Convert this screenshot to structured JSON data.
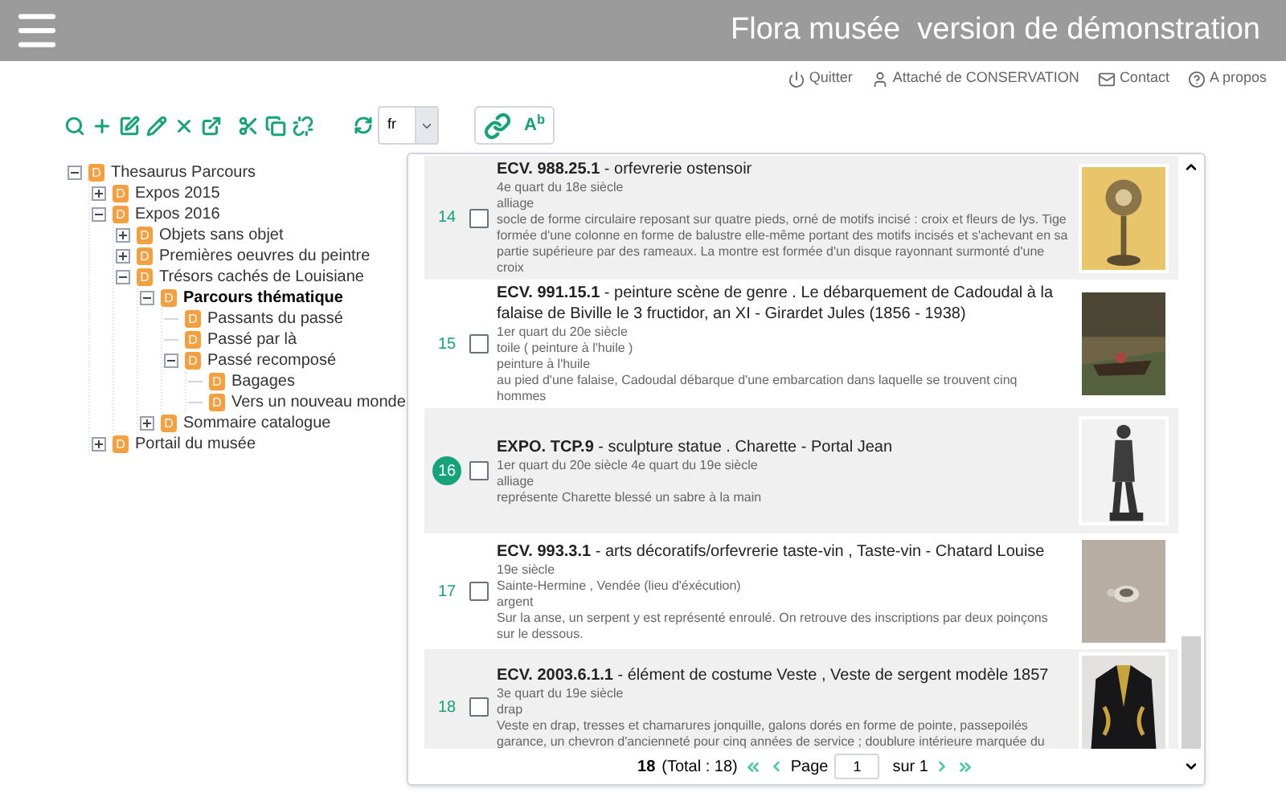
{
  "header": {
    "title": "Flora musée  version de démonstration"
  },
  "user_links": [
    {
      "kind": "power",
      "label": "Quitter"
    },
    {
      "kind": "user",
      "label": "Attaché de CONSERVATION"
    },
    {
      "kind": "mail",
      "label": "Contact"
    },
    {
      "kind": "help",
      "label": "A propos"
    }
  ],
  "toolbar": {
    "language": "fr",
    "format_label": "A$^{b}$"
  },
  "tree": [
    {
      "label": "Thesaurus Parcours",
      "badge": "D",
      "expanded": true,
      "bold": false,
      "children": [
        {
          "label": "Expos 2015",
          "badge": "D",
          "expanded": false,
          "bold": false
        },
        {
          "label": "Expos 2016",
          "badge": "D",
          "expanded": true,
          "bold": false,
          "children": [
            {
              "label": "Objets sans objet",
              "badge": "D",
              "expanded": false,
              "bold": false
            },
            {
              "label": "Premières oeuvres du peintre",
              "badge": "D",
              "expanded": false,
              "bold": false
            },
            {
              "label": "Trésors cachés de Louisiane",
              "badge": "D",
              "expanded": true,
              "bold": false,
              "children": [
                {
                  "label": "Parcours thématique",
                  "badge": "D",
                  "expanded": true,
                  "bold": true,
                  "children": [
                    {
                      "label": "Passants du passé",
                      "badge": "D"
                    },
                    {
                      "label": "Passé par là",
                      "badge": "D"
                    },
                    {
                      "label": "Passé recomposé",
                      "badge": "D",
                      "expanded": true,
                      "bold": false,
                      "children": [
                        {
                          "label": "Bagages",
                          "badge": "D"
                        },
                        {
                          "label": "Vers un nouveau monde",
                          "badge": "D"
                        }
                      ]
                    }
                  ]
                },
                {
                  "label": "Sommaire catalogue",
                  "badge": "D",
                  "expanded": false,
                  "bold": false
                }
              ]
            }
          ]
        },
        {
          "label": "Portail du musée",
          "badge": "D",
          "expanded": false,
          "bold": false
        }
      ]
    }
  ],
  "results": [
    {
      "number": "14",
      "selected": false,
      "checked": false,
      "title": "**ECV. 988.25.1** - orfevrerie ostensoir",
      "details": [
        "4e quart du 18e siècle",
        "alliage",
        "socle de forme circulaire reposant sur quatre pieds, orné de motifs incisé : croix et fleurs de lys. Tige formée d'une colonne en forme de balustre elle-même portant des motifs incisés et s'achevant en sa partie supérieure par des rameaux. La montre est formée d'un disque rayonnant surmonté d'une croix"
      ]
    },
    {
      "number": "15",
      "selected": false,
      "checked": false,
      "title": "**ECV. 991.15.1** - peinture scène de genre . Le débarquement de Cadoudal à la falaise de Biville le 3 fructidor, an XI - Girardet Jules  (1856 - 1938)",
      "details": [
        "1er quart du 20e siècle",
        "toile ( peinture à l'huile )",
        "peinture à l'huile",
        "au pied d'une falaise, Cadoudal débarque d'une embarcation dans laquelle se trouvent cinq hommes"
      ]
    },
    {
      "number": "16",
      "selected": true,
      "checked": false,
      "title": "**EXPO. TCP.9** - sculpture statue . Charette - Portal Jean",
      "details": [
        "1er quart du 20e siècle 4e quart du 19e siècle",
        "alliage",
        "représente Charette blessé un sabre à la main"
      ]
    },
    {
      "number": "17",
      "selected": false,
      "checked": false,
      "title": "**ECV. 993.3.1** - arts décoratifs/orfevrerie taste-vin , Taste-vin - Chatard Louise",
      "details": [
        "19e siècle",
        "Sainte-Hermine , Vendée (lieu d'éxécution)",
        "argent",
        "Sur la anse, un serpent y est représenté enroulé. On retrouve des inscriptions par deux poinçons sur le dessous."
      ]
    },
    {
      "number": "18",
      "selected": false,
      "checked": false,
      "title": "**ECV. 2003.6.1.1** - élément de costume Veste , Veste de sergent modèle 1857",
      "details": [
        "3e quart du 19e siècle",
        "drap",
        "Veste en drap, tresses et chamarures jonquille, galons dorés en forme de pointe, passepoilés garance, un chevron d'ancienneté pour cinq années de service ; doublure intérieure marquée du"
      ]
    }
  ],
  "pagination": {
    "count": "18",
    "total": "(Total : 18)",
    "page_label": "Page",
    "page": "1",
    "of": "sur 1"
  }
}
